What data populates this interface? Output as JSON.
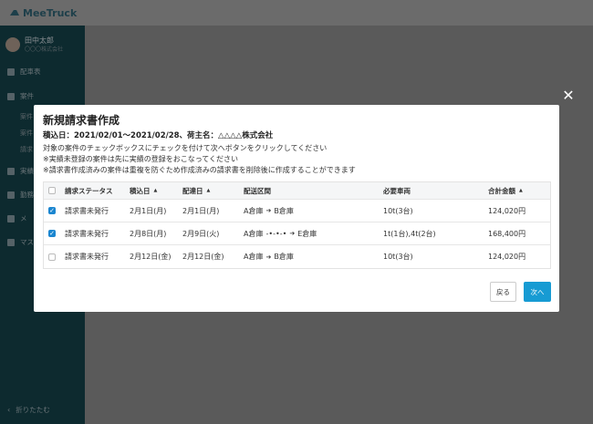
{
  "app": {
    "logo_text": "MeeTruck",
    "brand_color": "#179bd3"
  },
  "sidebar": {
    "user_name": "田中太郎",
    "user_company": "〇〇〇株式会社",
    "items": [
      {
        "label": "配車表",
        "icon": "calendar-icon"
      },
      {
        "label": "案件",
        "icon": "folder-icon"
      },
      {
        "label": "案件",
        "icon": "list-icon"
      },
      {
        "label": "実績",
        "icon": "chart-icon"
      },
      {
        "label": "勤務",
        "icon": "clock-icon"
      },
      {
        "label": "メ",
        "icon": "send-icon"
      },
      {
        "label": "マス",
        "icon": "database-icon"
      }
    ],
    "sub_items": [
      "案件",
      "案件",
      "請求"
    ],
    "collapse_label": "折りたたむ"
  },
  "modal": {
    "close_icon": "close-icon",
    "title": "新規請求書作成",
    "meta": "積込日：2021/02/01〜2021/02/28、荷主名：△△△△株式会社",
    "notes": [
      "対象の案件のチェックボックスにチェックを付けて次へボタンをクリックしてください",
      "※実績未登録の案件は先に実績の登録をおこなってください",
      "※請求書作成済みの案件は重複を防ぐため作成済みの請求書を削除後に作成することができます"
    ],
    "table": {
      "headers": {
        "status": "請求ステータス",
        "load_date": "積込日",
        "delivery_date": "配達日",
        "route": "配送区間",
        "vehicles": "必要車両",
        "total": "合計金額"
      },
      "rows": [
        {
          "checked": true,
          "status": "請求書未発行",
          "load_date": "2月1日(月)",
          "delivery_date": "2月1日(月)",
          "route_from": "A倉庫",
          "route_mid": "",
          "route_to": "B倉庫",
          "vehicles": "10t(3台)",
          "total": "124,020円"
        },
        {
          "checked": true,
          "status": "請求書未発行",
          "load_date": "2月8日(月)",
          "delivery_date": "2月9日(火)",
          "route_from": "A倉庫",
          "route_mid": "-•-•-•",
          "route_to": "E倉庫",
          "vehicles": "1t(1台),4t(2台)",
          "total": "168,400円"
        },
        {
          "checked": false,
          "status": "請求書未発行",
          "load_date": "2月12日(金)",
          "delivery_date": "2月12日(金)",
          "route_from": "A倉庫",
          "route_mid": "",
          "route_to": "B倉庫",
          "vehicles": "10t(3台)",
          "total": "124,020円"
        }
      ]
    },
    "buttons": {
      "back": "戻る",
      "next": "次へ"
    }
  }
}
